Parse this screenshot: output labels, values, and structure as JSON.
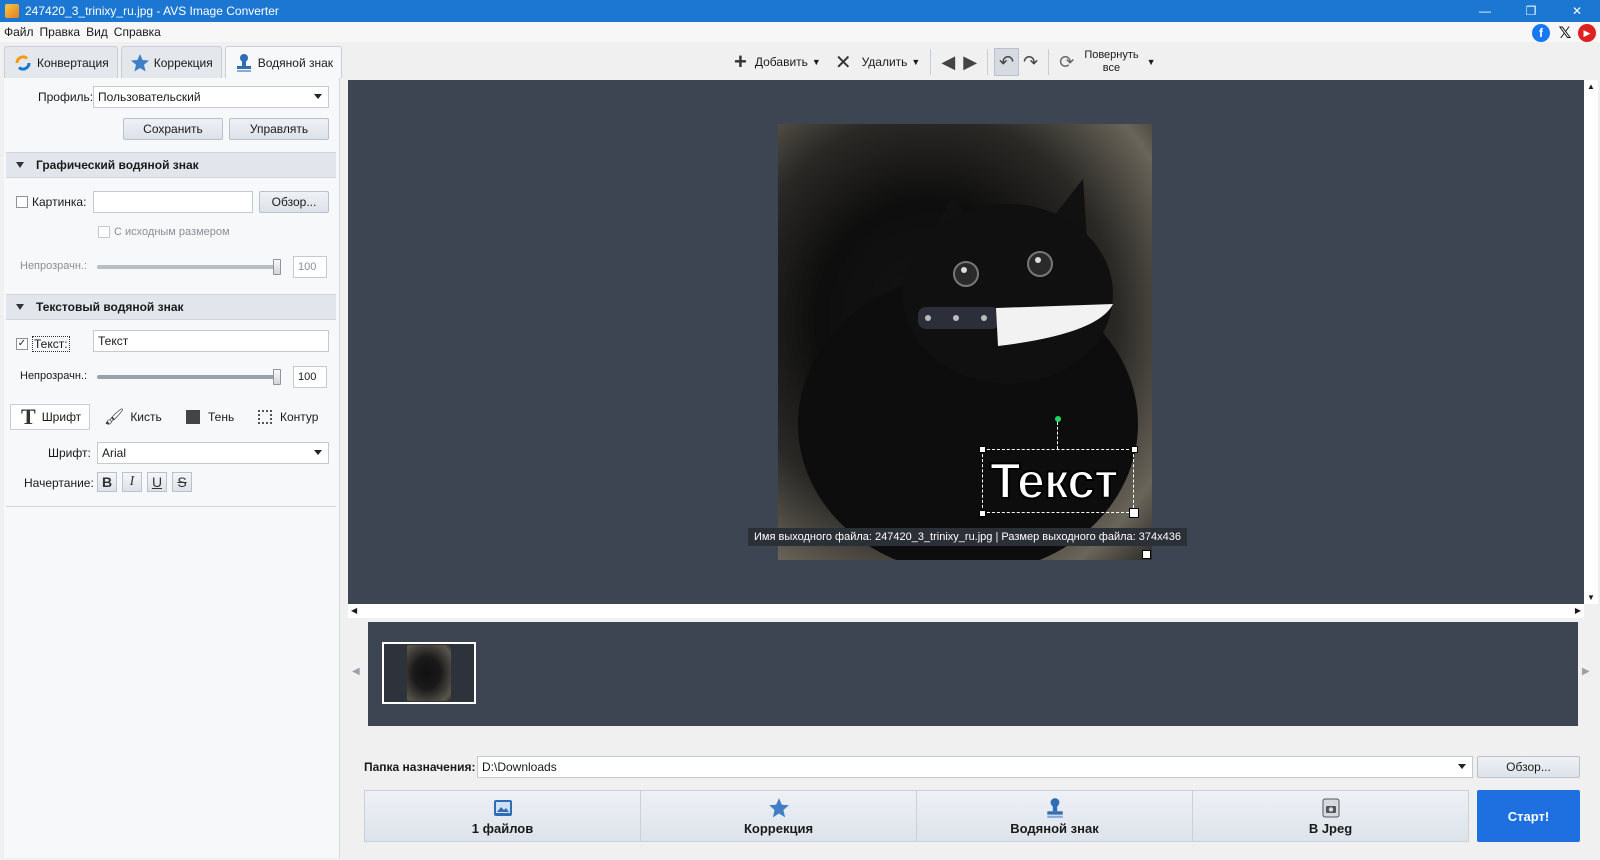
{
  "window": {
    "title": "247420_3_trinixy_ru.jpg - AVS Image Converter",
    "controls": [
      "—",
      "❐",
      "✕"
    ]
  },
  "menu": [
    "Файл",
    "Правка",
    "Вид",
    "Справка"
  ],
  "social": [
    "facebook-icon",
    "x-icon",
    "youtube-icon"
  ],
  "tabs": [
    {
      "label": "Конвертация",
      "icon": "convert-icon"
    },
    {
      "label": "Коррекция",
      "icon": "star-icon"
    },
    {
      "label": "Водяной знак",
      "icon": "stamp-icon",
      "active": true
    }
  ],
  "toolbar": {
    "add": "Добавить",
    "delete": "Удалить",
    "rotate_all_line1": "Повернуть",
    "rotate_all_line2": "все"
  },
  "left": {
    "profile_label": "Профиль:",
    "profile_value": "Пользовательский",
    "save": "Сохранить",
    "manage": "Управлять",
    "graphic_section": "Графический водяной знак",
    "picture_label": "Картинка:",
    "picture_value": "",
    "browse": "Обзор...",
    "original_size": "С исходным размером",
    "opacity_label": "Непрозрачн.:",
    "opacity_graphic": "100",
    "text_section": "Текстовый водяной знак",
    "text_label": "Текст:",
    "text_value": "Текст",
    "opacity_text": "100",
    "font_tab": "Шрифт",
    "brush_tab": "Кисть",
    "shadow_tab": "Тень",
    "outline_tab": "Контур",
    "font_label": "Шрифт:",
    "font_value": "Arial",
    "style_label": "Начертание:",
    "style_buttons": [
      "B",
      "I",
      "U",
      "S"
    ],
    "picture_checked": false,
    "text_checked": true,
    "opacity_graphic_level": 1.0,
    "opacity_text_level": 1.0
  },
  "preview": {
    "watermark_text": "Текст",
    "tooltip": "Имя выходного файла: 247420_3_trinixy_ru.jpg | Размер выходного файла: 374x436"
  },
  "bottom": {
    "dest_label": "Папка назначения:",
    "dest_value": "D:\\Downloads",
    "browse": "Обзор...",
    "steps": [
      "1 файлов",
      "Коррекция",
      "Водяной знак",
      "В Jpeg"
    ],
    "start": "Старт!"
  },
  "colors": {
    "titlebar": "#1b77d2",
    "preview_bg": "#3e4552",
    "start_button": "#1e6fe0"
  }
}
